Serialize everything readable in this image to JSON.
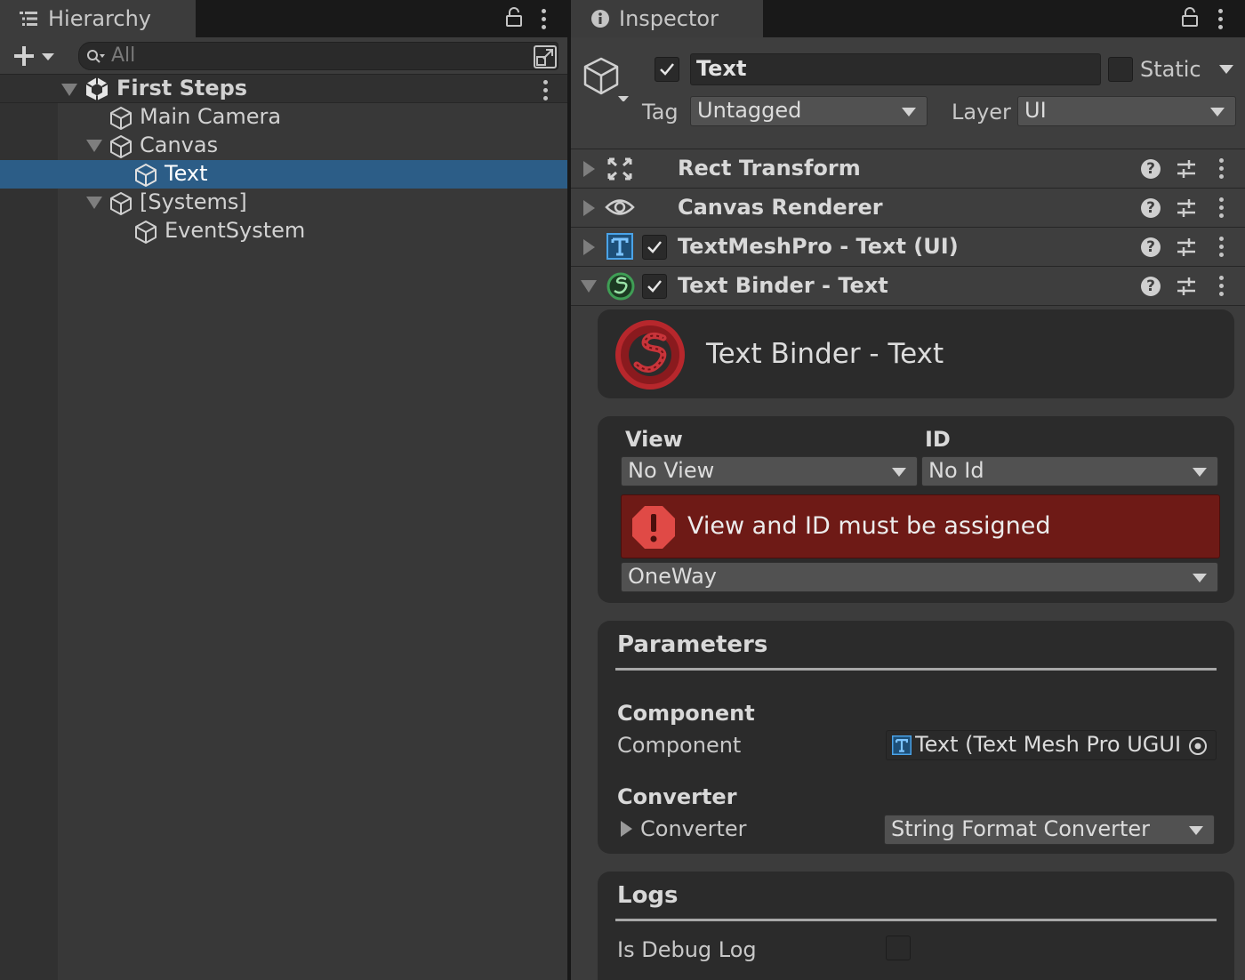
{
  "hierarchy": {
    "tab_label": "Hierarchy",
    "search_placeholder": "All",
    "scene": {
      "name": "First Steps"
    },
    "items": [
      {
        "label": "Main Camera"
      },
      {
        "label": "Canvas"
      },
      {
        "label": "Text"
      },
      {
        "label": "[Systems]"
      },
      {
        "label": "EventSystem"
      }
    ]
  },
  "inspector": {
    "tab_label": "Inspector",
    "object": {
      "name": "Text",
      "active": true,
      "static_label": "Static",
      "static": false,
      "tag_label": "Tag",
      "tag_value": "Untagged",
      "layer_label": "Layer",
      "layer_value": "UI"
    },
    "components": [
      {
        "name": "Rect Transform",
        "icon": "rect-transform-icon"
      },
      {
        "name": "Canvas Renderer",
        "icon": "eye-icon"
      },
      {
        "name": "TextMeshPro - Text (UI)",
        "icon": "textmeshpro-icon",
        "enabled": true
      },
      {
        "name": "Text Binder - Text",
        "icon": "binder-icon",
        "enabled": true,
        "expanded": true
      }
    ],
    "binder": {
      "title": "Text Binder - Text",
      "view_label": "View",
      "view_value": "No View",
      "id_label": "ID",
      "id_value": "No Id",
      "error_message": "View and ID must be assigned",
      "mode_value": "OneWay",
      "parameters_title": "Parameters",
      "component_header": "Component",
      "component_label": "Component",
      "component_value": "Text (Text Mesh Pro UGUI)",
      "converter_header": "Converter",
      "converter_label": "Converter",
      "converter_value": "String Format Converter",
      "logs_title": "Logs",
      "debug_label": "Is Debug Log",
      "debug_value": false
    }
  },
  "colors": {
    "selection": "#2c5d87",
    "error_background": "#6e1a16",
    "error_icon": "#e04a46",
    "textmeshpro_blue": "#4aa3e8"
  }
}
